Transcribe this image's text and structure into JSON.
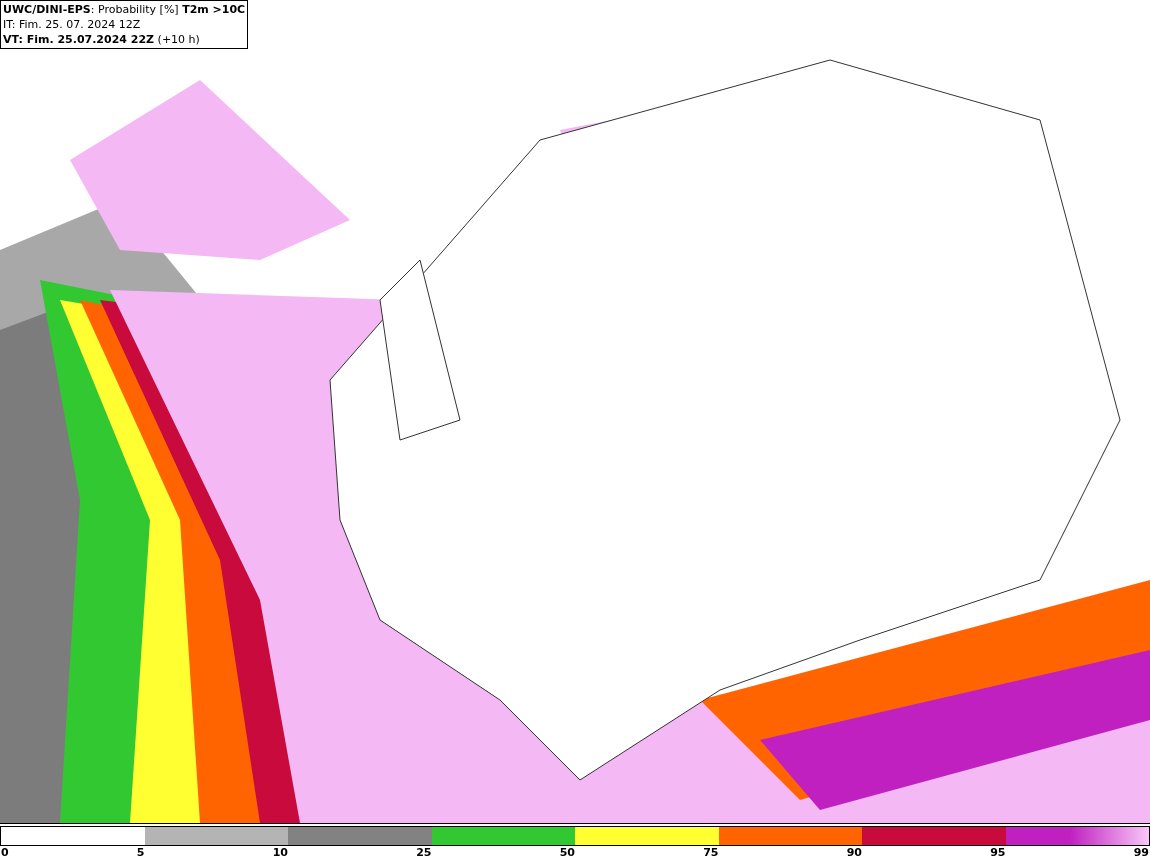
{
  "header": {
    "title": "**UWC/DINI-EPS**: Probability [%] **T2m >10C**",
    "issue_time": "IT: Fim. 25. 07. 2024 12Z",
    "valid_time": "**VT: Fim. 25.07.2024 22Z** (+10 h)"
  },
  "legend": {
    "bins": [
      {
        "color": "#ffffff"
      },
      {
        "color": "#b4b4b4"
      },
      {
        "color": "#828282"
      },
      {
        "color": "#32c832"
      },
      {
        "color": "#ffff32"
      },
      {
        "color": "#ff6400"
      },
      {
        "color": "#c80a3c"
      },
      {
        "color": "#c020c0"
      }
    ],
    "ticks": [
      "0",
      "5",
      "10",
      "25",
      "50",
      "75",
      "90",
      "95",
      "99"
    ]
  }
}
